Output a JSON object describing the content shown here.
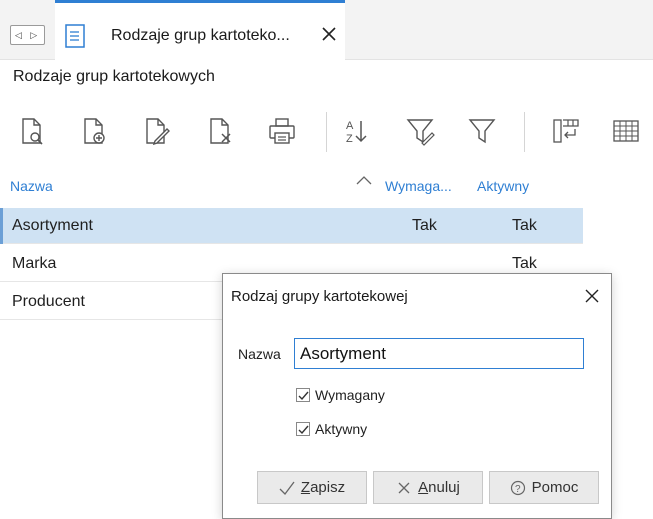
{
  "tab": {
    "nav_toggle": "◁ ▷",
    "title": "Rodzaje grup kartoteko..."
  },
  "view": {
    "title": "Rodzaje grup kartotekowych"
  },
  "toolbar": {
    "icons": [
      "view-document-icon",
      "add-document-icon",
      "edit-document-icon",
      "delete-document-icon",
      "print-icon",
      "sort-az-icon",
      "filter-edit-icon",
      "filter-icon",
      "column-chooser-icon",
      "grid-icon"
    ],
    "sort_label_top": "A",
    "sort_label_bottom": "Z"
  },
  "grid": {
    "columns": {
      "name": "Nazwa",
      "required": "Wymaga...",
      "active": "Aktywny"
    },
    "rows": [
      {
        "name": "Asortyment",
        "required": "Tak",
        "active": "Tak"
      },
      {
        "name": "Marka",
        "required": "",
        "active": "Tak"
      },
      {
        "name": "Producent",
        "required": "",
        "active": ""
      }
    ]
  },
  "dialog": {
    "title": "Rodzaj grupy kartotekowej",
    "name_label": "Nazwa",
    "name_value": "Asortyment",
    "required_label": "Wymagany",
    "required_checked": true,
    "active_label": "Aktywny",
    "active_checked": true,
    "save_mnemonic": "Z",
    "save_rest": "apisz",
    "cancel_mnemonic": "A",
    "cancel_rest": "nuluj",
    "help_label": "Pomoc"
  },
  "colors": {
    "accent": "#2f7fd3",
    "selection": "#cfe2f3"
  }
}
